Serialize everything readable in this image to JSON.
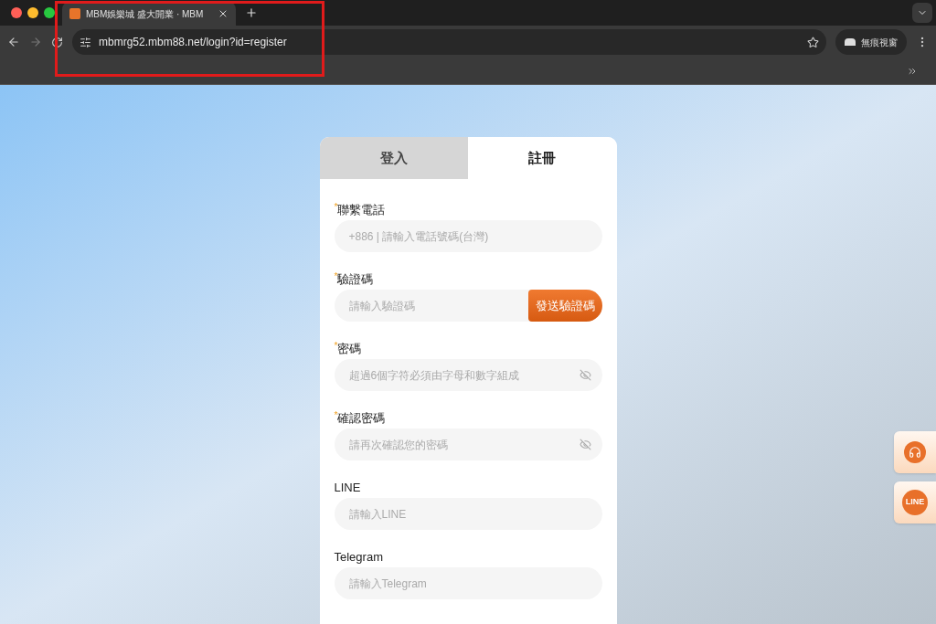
{
  "browser": {
    "tab": {
      "title": "MBM娛樂城 盛大開業 · MBM",
      "selected": true
    },
    "url": "mbmrg52.mbm88.net/login?id=register",
    "incognito_label": "無痕視窗"
  },
  "form": {
    "tabs": [
      {
        "label": "登入",
        "selected": false
      },
      {
        "label": "註冊",
        "selected": true
      }
    ],
    "fields": [
      {
        "kind": "text",
        "label": "聯繫電話",
        "marker": "*",
        "placeholder": "+886 | 請輸入電話號碼(台灣)"
      },
      {
        "kind": "code",
        "label": "驗證碼",
        "marker": "*",
        "placeholder": "請輸入驗證碼",
        "button": "發送驗證碼"
      },
      {
        "kind": "password",
        "label": "密碼",
        "marker": "*",
        "placeholder": "超過6個字符必須由字母和數字組成"
      },
      {
        "kind": "password",
        "label": "確認密碼",
        "marker": "*",
        "placeholder": "請再次確認您的密碼"
      },
      {
        "kind": "text",
        "label": "LINE",
        "placeholder": "請輸入LINE"
      },
      {
        "kind": "text",
        "label": "Telegram",
        "placeholder": "請輸入Telegram"
      }
    ]
  },
  "side_buttons": [
    {
      "kind": "support"
    },
    {
      "kind": "line",
      "label": "LINE"
    }
  ]
}
